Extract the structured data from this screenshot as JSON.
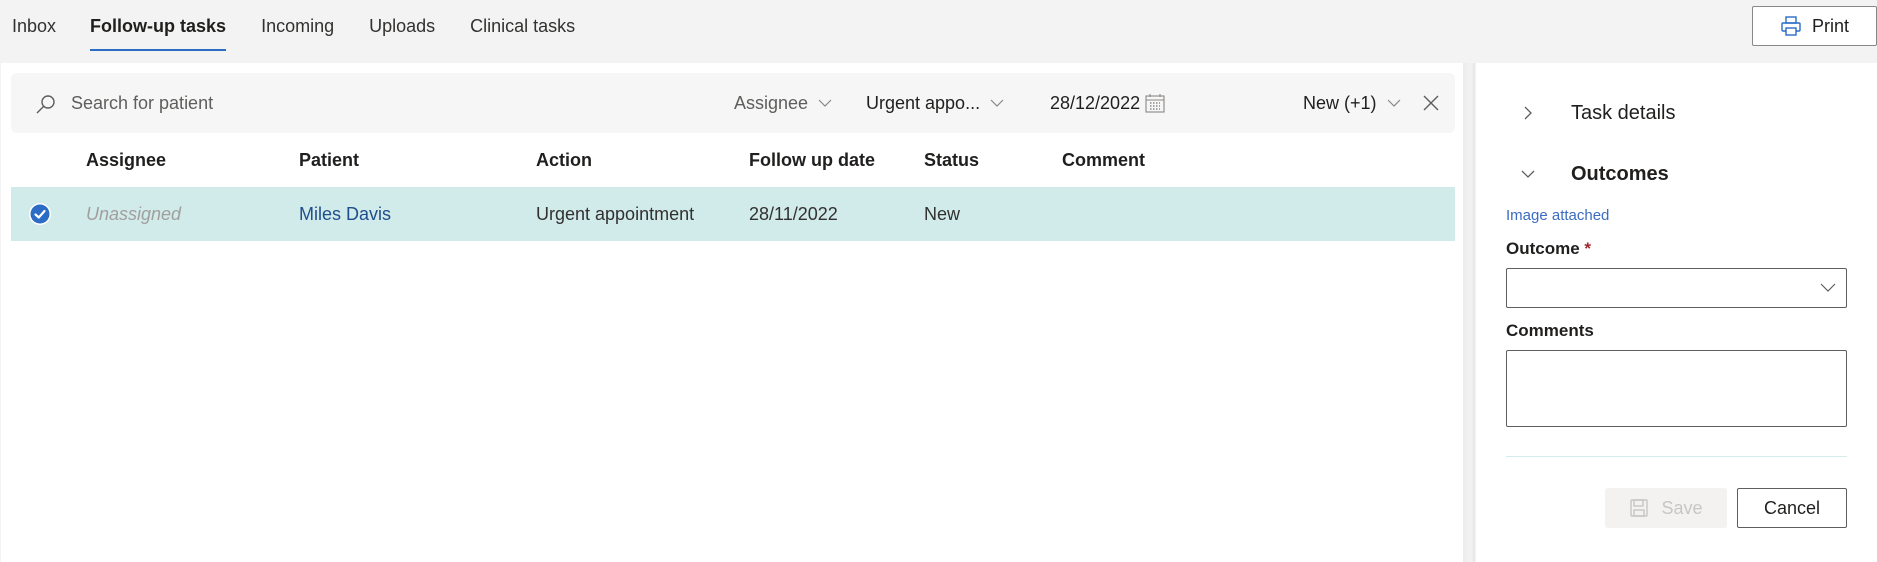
{
  "tabs": [
    {
      "label": "Inbox",
      "active": false
    },
    {
      "label": "Follow-up tasks",
      "active": true
    },
    {
      "label": "Incoming",
      "active": false
    },
    {
      "label": "Uploads",
      "active": false
    },
    {
      "label": "Clinical tasks",
      "active": false
    }
  ],
  "toolbar": {
    "print_label": "Print",
    "print_icon": "printer-icon"
  },
  "filters": {
    "search_placeholder": "Search for patient",
    "search_value": "",
    "assignee_label": "Assignee",
    "action_value": "Urgent appo...",
    "date_value": "28/12/2022",
    "status_value": "New (+1)",
    "clear_icon": "close-icon"
  },
  "table": {
    "columns": [
      "Assignee",
      "Patient",
      "Action",
      "Follow up date",
      "Status",
      "Comment"
    ],
    "rows": [
      {
        "selected": true,
        "assignee": "Unassigned",
        "patient": "Miles Davis",
        "action": "Urgent appointment",
        "follow_up_date": "28/11/2022",
        "status": "New",
        "comment": ""
      }
    ]
  },
  "side_panel": {
    "task_details_title": "Task details",
    "task_details_expanded": false,
    "outcomes_title": "Outcomes",
    "outcomes_expanded": true,
    "image_link": "Image attached",
    "outcome_label": "Outcome",
    "outcome_required_marker": "*",
    "outcome_value": "",
    "comments_label": "Comments",
    "comments_value": "",
    "save_label": "Save",
    "save_enabled": false,
    "cancel_label": "Cancel"
  },
  "colors": {
    "accent": "#2b6cc4",
    "selected_row": "#d1eaea",
    "link": "#3a6cc2",
    "required": "#a4262c"
  }
}
